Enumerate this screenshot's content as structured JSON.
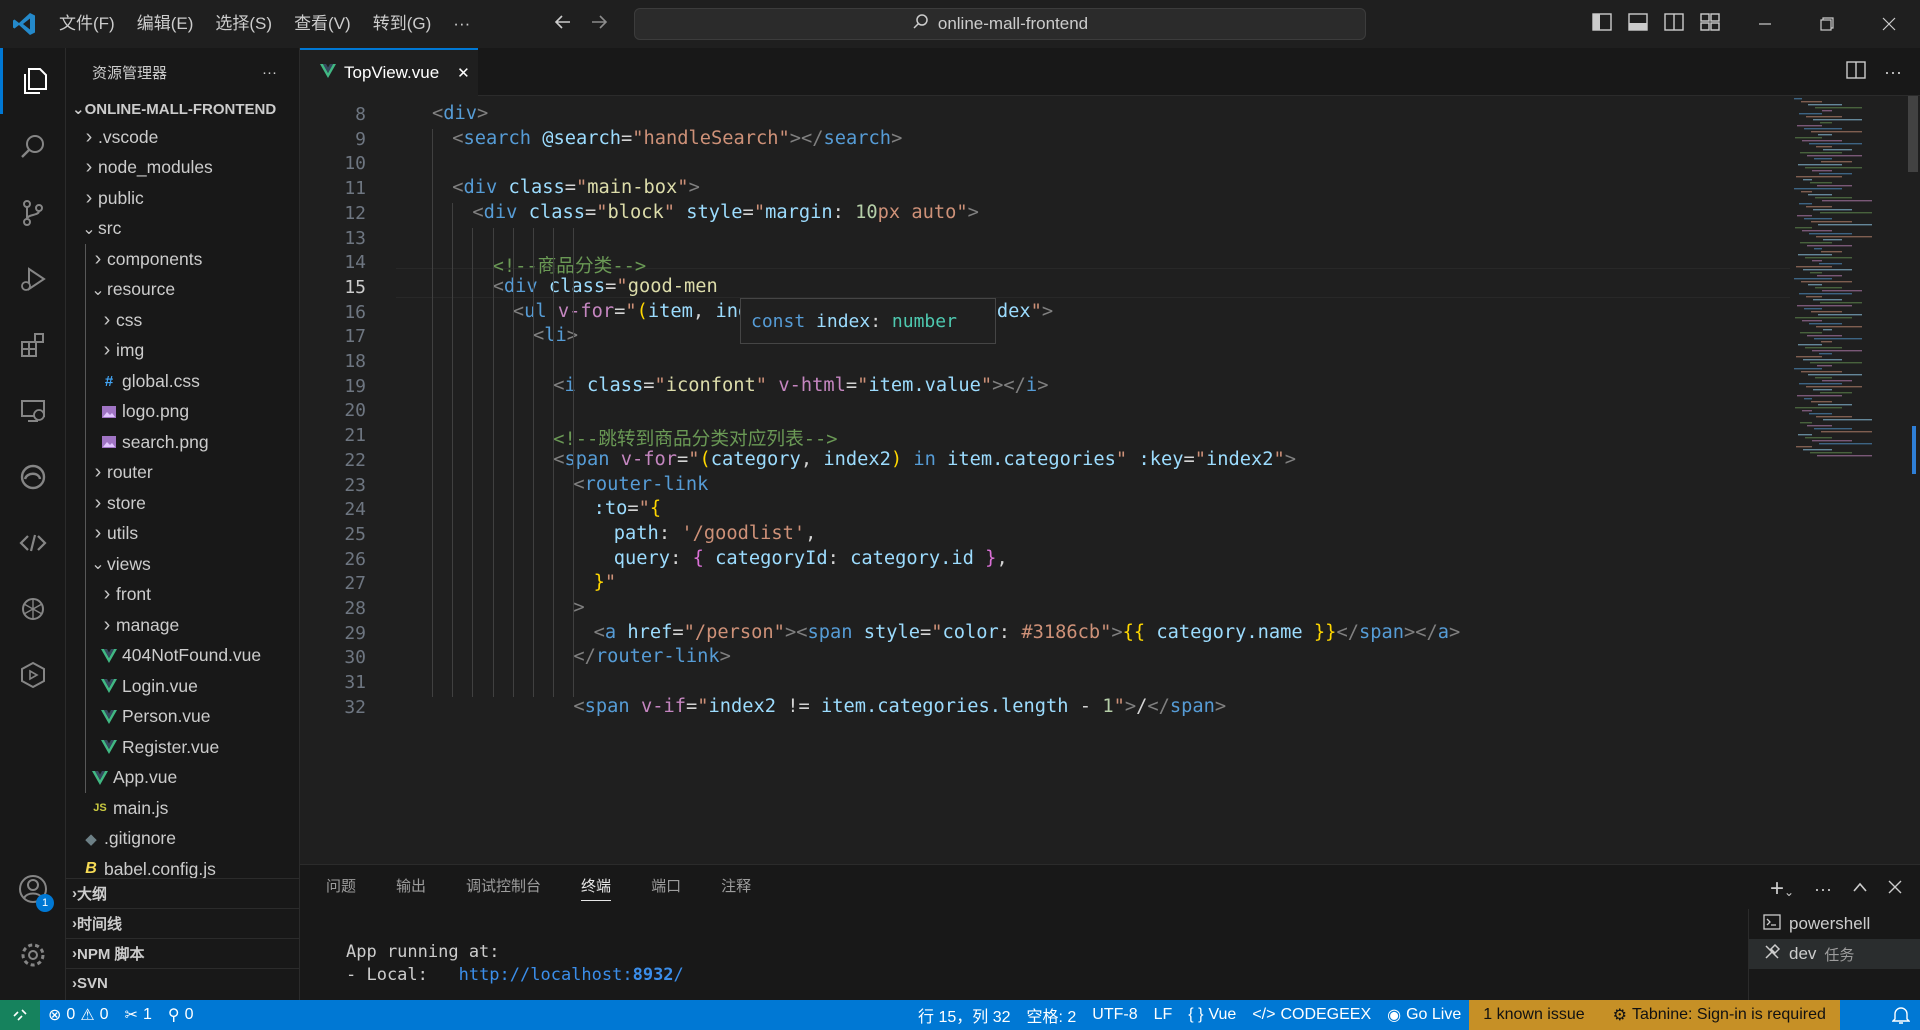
{
  "titlebar": {
    "menus": [
      "文件(F)",
      "编辑(E)",
      "选择(S)",
      "查看(V)",
      "转到(G)",
      "···"
    ],
    "search": "online-mall-frontend"
  },
  "activity": {
    "account_badge": "1"
  },
  "sidebar": {
    "title": "资源管理器",
    "more": "···",
    "project": "ONLINE-MALL-FRONTEND",
    "items": [
      {
        "label": ".vscode",
        "type": "folder",
        "open": false,
        "depth": 0
      },
      {
        "label": "node_modules",
        "type": "folder",
        "open": false,
        "depth": 0
      },
      {
        "label": "public",
        "type": "folder",
        "open": false,
        "depth": 0
      },
      {
        "label": "src",
        "type": "folder",
        "open": true,
        "depth": 0
      },
      {
        "label": "components",
        "type": "folder",
        "open": false,
        "depth": 1
      },
      {
        "label": "resource",
        "type": "folder",
        "open": true,
        "depth": 1
      },
      {
        "label": "css",
        "type": "folder",
        "open": false,
        "depth": 2
      },
      {
        "label": "img",
        "type": "folder",
        "open": false,
        "depth": 2
      },
      {
        "label": "global.css",
        "type": "css",
        "depth": 2
      },
      {
        "label": "logo.png",
        "type": "png",
        "depth": 2
      },
      {
        "label": "search.png",
        "type": "png",
        "depth": 2
      },
      {
        "label": "router",
        "type": "folder",
        "open": false,
        "depth": 1
      },
      {
        "label": "store",
        "type": "folder",
        "open": false,
        "depth": 1
      },
      {
        "label": "utils",
        "type": "folder",
        "open": false,
        "depth": 1
      },
      {
        "label": "views",
        "type": "folder",
        "open": true,
        "depth": 1
      },
      {
        "label": "front",
        "type": "folder",
        "open": false,
        "depth": 2
      },
      {
        "label": "manage",
        "type": "folder",
        "open": false,
        "depth": 2
      },
      {
        "label": "404NotFound.vue",
        "type": "vue",
        "depth": 2
      },
      {
        "label": "Login.vue",
        "type": "vue",
        "depth": 2
      },
      {
        "label": "Person.vue",
        "type": "vue",
        "depth": 2
      },
      {
        "label": "Register.vue",
        "type": "vue",
        "depth": 2
      },
      {
        "label": "App.vue",
        "type": "vue",
        "depth": 1
      },
      {
        "label": "main.js",
        "type": "js",
        "depth": 1
      },
      {
        "label": ".gitignore",
        "type": "git",
        "depth": 0
      },
      {
        "label": "babel.config.js",
        "type": "babel",
        "depth": 0
      }
    ],
    "sections": [
      "大纲",
      "时间线",
      "NPM 脚本",
      "SVN"
    ]
  },
  "tab": {
    "label": "TopView.vue",
    "close": "✕"
  },
  "editor": {
    "current_line": 15,
    "hover": [
      "const",
      " ",
      "index",
      ": ",
      "number"
    ],
    "lines": [
      {
        "n": "8",
        "indent": 0,
        "tokens": [
          [
            "t-br",
            "<"
          ],
          [
            "t-tag",
            "div"
          ],
          [
            "t-br",
            ">"
          ]
        ]
      },
      {
        "n": "9",
        "indent": 1,
        "tokens": [
          [
            "t-br",
            "<"
          ],
          [
            "t-tag",
            "search"
          ],
          [
            "t-plain",
            " "
          ],
          [
            "t-attr",
            "@search"
          ],
          [
            "t-plain",
            "="
          ],
          [
            "t-str",
            "\"handleSearch\""
          ],
          [
            "t-br",
            "></"
          ],
          [
            "t-tag",
            "search"
          ],
          [
            "t-br",
            ">"
          ]
        ]
      },
      {
        "n": "10",
        "indent": 0,
        "tokens": []
      },
      {
        "n": "11",
        "indent": 1,
        "tokens": [
          [
            "t-br",
            "<"
          ],
          [
            "t-tag",
            "div"
          ],
          [
            "t-plain",
            " "
          ],
          [
            "t-attr",
            "class"
          ],
          [
            "t-plain",
            "="
          ],
          [
            "t-str",
            "\""
          ],
          [
            "t-fn",
            "main-box"
          ],
          [
            "t-str",
            "\""
          ],
          [
            "t-br",
            ">"
          ]
        ]
      },
      {
        "n": "12",
        "indent": 2,
        "tokens": [
          [
            "t-br",
            "<"
          ],
          [
            "t-tag",
            "div"
          ],
          [
            "t-plain",
            " "
          ],
          [
            "t-attr",
            "class"
          ],
          [
            "t-plain",
            "="
          ],
          [
            "t-str",
            "\""
          ],
          [
            "t-fn",
            "block"
          ],
          [
            "t-str",
            "\""
          ],
          [
            "t-plain",
            " "
          ],
          [
            "t-attr",
            "style"
          ],
          [
            "t-plain",
            "="
          ],
          [
            "t-str",
            "\""
          ],
          [
            "t-attr",
            "margin"
          ],
          [
            "t-plain",
            ": "
          ],
          [
            "t-num",
            "10"
          ],
          [
            "t-str",
            "px auto"
          ],
          [
            "t-str",
            "\""
          ],
          [
            "t-br",
            ">"
          ]
        ]
      },
      {
        "n": "13",
        "indent": 0,
        "tokens": []
      },
      {
        "n": "14",
        "indent": 3,
        "tokens": [
          [
            "t-com",
            "<!--商品分类-->"
          ]
        ]
      },
      {
        "n": "15",
        "indent": 3,
        "tokens": [
          [
            "t-br",
            "<"
          ],
          [
            "t-tag",
            "div"
          ],
          [
            "t-plain",
            " "
          ],
          [
            "t-attr",
            "class"
          ],
          [
            "t-plain",
            "="
          ],
          [
            "t-str",
            "\""
          ],
          [
            "t-fn",
            "good-men"
          ]
        ]
      },
      {
        "n": "16",
        "indent": 4,
        "tokens": [
          [
            "t-br",
            "<"
          ],
          [
            "t-tag",
            "ul"
          ],
          [
            "t-plain",
            " "
          ],
          [
            "t-ctl",
            "v-for"
          ],
          [
            "t-plain",
            "="
          ],
          [
            "t-str",
            "\""
          ],
          [
            "t-y",
            "("
          ],
          [
            "t-var",
            "item"
          ],
          [
            "t-plain",
            ", "
          ],
          [
            "t-var",
            "index"
          ],
          [
            "t-y",
            ")"
          ],
          [
            "t-plain",
            " "
          ],
          [
            "t-const",
            "in"
          ],
          [
            "t-plain",
            " "
          ],
          [
            "t-var",
            "icons"
          ],
          [
            "t-str",
            "\""
          ],
          [
            "t-plain",
            " "
          ],
          [
            "t-attr",
            ":key"
          ],
          [
            "t-plain",
            "="
          ],
          [
            "t-str",
            "\""
          ],
          [
            "t-var",
            "index"
          ],
          [
            "t-str",
            "\""
          ],
          [
            "t-br",
            ">"
          ]
        ]
      },
      {
        "n": "17",
        "indent": 5,
        "tokens": [
          [
            "t-br",
            "<"
          ],
          [
            "t-tag",
            "li"
          ],
          [
            "t-br",
            ">"
          ]
        ]
      },
      {
        "n": "18",
        "indent": 0,
        "tokens": []
      },
      {
        "n": "19",
        "indent": 6,
        "tokens": [
          [
            "t-br",
            "<"
          ],
          [
            "t-tag",
            "i"
          ],
          [
            "t-plain",
            " "
          ],
          [
            "t-attr",
            "class"
          ],
          [
            "t-plain",
            "="
          ],
          [
            "t-str",
            "\""
          ],
          [
            "t-fn",
            "iconfont"
          ],
          [
            "t-str",
            "\""
          ],
          [
            "t-plain",
            " "
          ],
          [
            "t-ctl",
            "v-html"
          ],
          [
            "t-plain",
            "="
          ],
          [
            "t-str",
            "\""
          ],
          [
            "t-var",
            "item.value"
          ],
          [
            "t-str",
            "\""
          ],
          [
            "t-br",
            "></"
          ],
          [
            "t-tag",
            "i"
          ],
          [
            "t-br",
            ">"
          ]
        ]
      },
      {
        "n": "20",
        "indent": 0,
        "tokens": []
      },
      {
        "n": "21",
        "indent": 6,
        "tokens": [
          [
            "t-com",
            "<!--跳转到商品分类对应列表-->"
          ]
        ]
      },
      {
        "n": "22",
        "indent": 6,
        "tokens": [
          [
            "t-br",
            "<"
          ],
          [
            "t-tag",
            "span"
          ],
          [
            "t-plain",
            " "
          ],
          [
            "t-ctl",
            "v-for"
          ],
          [
            "t-plain",
            "="
          ],
          [
            "t-str",
            "\""
          ],
          [
            "t-y",
            "("
          ],
          [
            "t-var",
            "category"
          ],
          [
            "t-plain",
            ", "
          ],
          [
            "t-var",
            "index2"
          ],
          [
            "t-y",
            ")"
          ],
          [
            "t-plain",
            " "
          ],
          [
            "t-const",
            "in"
          ],
          [
            "t-plain",
            " "
          ],
          [
            "t-var",
            "item.categories"
          ],
          [
            "t-str",
            "\""
          ],
          [
            "t-plain",
            " "
          ],
          [
            "t-attr",
            ":key"
          ],
          [
            "t-plain",
            "="
          ],
          [
            "t-str",
            "\""
          ],
          [
            "t-var",
            "index2"
          ],
          [
            "t-str",
            "\""
          ],
          [
            "t-br",
            ">"
          ]
        ]
      },
      {
        "n": "23",
        "indent": 7,
        "tokens": [
          [
            "t-br",
            "<"
          ],
          [
            "t-tag",
            "router-link"
          ]
        ]
      },
      {
        "n": "24",
        "indent": 8,
        "tokens": [
          [
            "t-attr",
            ":to"
          ],
          [
            "t-plain",
            "="
          ],
          [
            "t-str",
            "\""
          ],
          [
            "t-y",
            "{"
          ]
        ]
      },
      {
        "n": "25",
        "indent": 9,
        "tokens": [
          [
            "t-var",
            "path"
          ],
          [
            "t-plain",
            ": "
          ],
          [
            "t-str",
            "'/goodlist'"
          ],
          [
            "t-plain",
            ","
          ]
        ]
      },
      {
        "n": "26",
        "indent": 9,
        "tokens": [
          [
            "t-var",
            "query"
          ],
          [
            "t-plain",
            ": "
          ],
          [
            "t-pur",
            "{"
          ],
          [
            "t-plain",
            " "
          ],
          [
            "t-var",
            "categoryId"
          ],
          [
            "t-plain",
            ": "
          ],
          [
            "t-var",
            "category.id"
          ],
          [
            "t-plain",
            " "
          ],
          [
            "t-pur",
            "}"
          ],
          [
            "t-plain",
            ","
          ]
        ]
      },
      {
        "n": "27",
        "indent": 8,
        "tokens": [
          [
            "t-y",
            "}"
          ],
          [
            "t-str",
            "\""
          ]
        ]
      },
      {
        "n": "28",
        "indent": 7,
        "tokens": [
          [
            "t-br",
            ">"
          ]
        ]
      },
      {
        "n": "29",
        "indent": 8,
        "tokens": [
          [
            "t-br",
            "<"
          ],
          [
            "t-tag",
            "a"
          ],
          [
            "t-plain",
            " "
          ],
          [
            "t-attr",
            "href"
          ],
          [
            "t-plain",
            "="
          ],
          [
            "t-str",
            "\"/person\""
          ],
          [
            "t-br",
            "><"
          ],
          [
            "t-tag",
            "span"
          ],
          [
            "t-plain",
            " "
          ],
          [
            "t-attr",
            "style"
          ],
          [
            "t-plain",
            "="
          ],
          [
            "t-str",
            "\""
          ],
          [
            "t-attr",
            "color"
          ],
          [
            "t-plain",
            ": "
          ],
          [
            "t-str",
            "#3186cb"
          ],
          [
            "t-str",
            "\""
          ],
          [
            "t-br",
            ">"
          ],
          [
            "t-y",
            "{{"
          ],
          [
            "t-plain",
            " "
          ],
          [
            "t-var",
            "category.name"
          ],
          [
            "t-plain",
            " "
          ],
          [
            "t-y",
            "}}"
          ],
          [
            "t-br",
            "</"
          ],
          [
            "t-tag",
            "span"
          ],
          [
            "t-br",
            "></"
          ],
          [
            "t-tag",
            "a"
          ],
          [
            "t-br",
            ">"
          ]
        ]
      },
      {
        "n": "30",
        "indent": 7,
        "tokens": [
          [
            "t-br",
            "</"
          ],
          [
            "t-tag",
            "router-link"
          ],
          [
            "t-br",
            ">"
          ]
        ]
      },
      {
        "n": "31",
        "indent": 0,
        "tokens": []
      },
      {
        "n": "32",
        "indent": 7,
        "tokens": [
          [
            "t-br",
            "<"
          ],
          [
            "t-tag",
            "span"
          ],
          [
            "t-plain",
            " "
          ],
          [
            "t-ctl",
            "v-if"
          ],
          [
            "t-plain",
            "="
          ],
          [
            "t-str",
            "\""
          ],
          [
            "t-var",
            "index2"
          ],
          [
            "t-plain",
            " != "
          ],
          [
            "t-var",
            "item.categories.length"
          ],
          [
            "t-plain",
            " - "
          ],
          [
            "t-num",
            "1"
          ],
          [
            "t-str",
            "\""
          ],
          [
            "t-br",
            ">"
          ],
          [
            "t-plain",
            "/"
          ],
          [
            "t-br",
            "</"
          ],
          [
            "t-tag",
            "span"
          ],
          [
            "t-br",
            ">"
          ]
        ]
      }
    ]
  },
  "panel": {
    "tabs": [
      "问题",
      "输出",
      "调试控制台",
      "终端",
      "端口",
      "注释"
    ],
    "active_tab": "终端",
    "terminal": {
      "line1": "App running at:",
      "line2_prefix": "- Local:   ",
      "line2_url": "http://localhost:",
      "line2_port": "8932",
      "line2_suffix": "/"
    },
    "instances": [
      {
        "label": "powershell",
        "extra": ""
      },
      {
        "label": "dev",
        "extra": "任务"
      }
    ]
  },
  "statusbar": {
    "errors": "0",
    "warnings": "0",
    "tools": "1",
    "ports": "0",
    "position": "行 15，列 32",
    "spaces": "空格: 2",
    "encoding": "UTF-8",
    "eol": "LF",
    "language": "Vue",
    "codegeex": "CODEGEEX",
    "golive": "Go Live",
    "issue": "1 known issue",
    "tabnine": "Tabnine: Sign-in is required"
  },
  "colors": {
    "accent": "#0078d4",
    "vue": "#41b883",
    "remote": "#16825d",
    "warning_bg": "#c69026"
  }
}
